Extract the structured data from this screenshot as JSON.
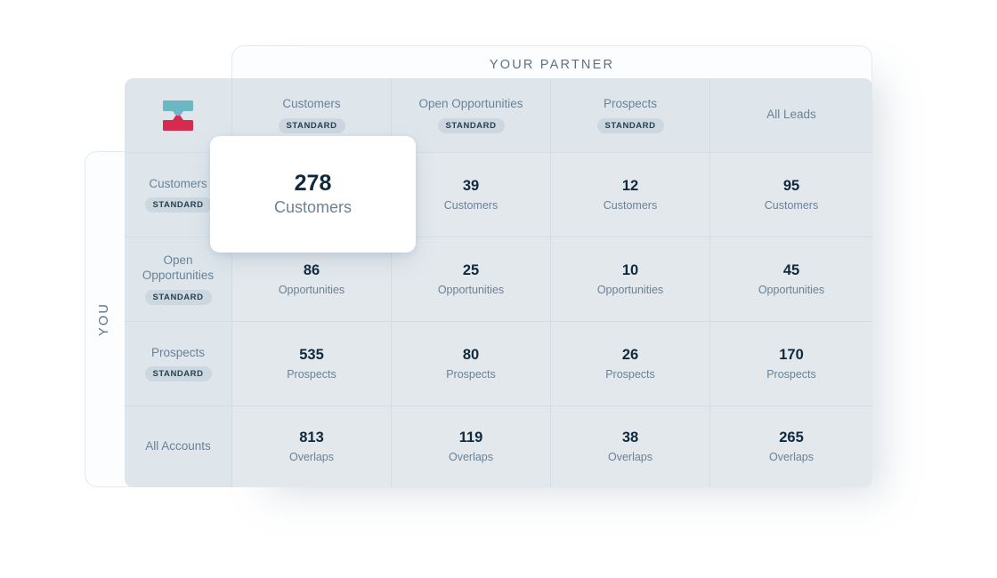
{
  "partner": {
    "title": "YOUR PARTNER"
  },
  "you": {
    "title": "YOU"
  },
  "logo": {
    "name": "crossbeam-logo-icon",
    "top_color": "#6bb8c4",
    "bottom_color": "#d52b4e"
  },
  "badge_label": "STANDARD",
  "columns": [
    {
      "label": "Customers",
      "badge": "STANDARD"
    },
    {
      "label": "Open Opportunities",
      "badge": "STANDARD"
    },
    {
      "label": "Prospects",
      "badge": "STANDARD"
    },
    {
      "label": "All Leads",
      "badge": ""
    }
  ],
  "rows": [
    {
      "label": "Customers",
      "badge": "STANDARD"
    },
    {
      "label": "Open Opportunities",
      "badge": "STANDARD"
    },
    {
      "label": "Prospects",
      "badge": "STANDARD"
    },
    {
      "label": "All Accounts",
      "badge": ""
    }
  ],
  "cells": [
    [
      {
        "value": "278",
        "label": "Customers"
      },
      {
        "value": "39",
        "label": "Customers"
      },
      {
        "value": "12",
        "label": "Customers"
      },
      {
        "value": "95",
        "label": "Customers"
      }
    ],
    [
      {
        "value": "86",
        "label": "Opportunities"
      },
      {
        "value": "25",
        "label": "Opportunities"
      },
      {
        "value": "10",
        "label": "Opportunities"
      },
      {
        "value": "45",
        "label": "Opportunities"
      }
    ],
    [
      {
        "value": "535",
        "label": "Prospects"
      },
      {
        "value": "80",
        "label": "Prospects"
      },
      {
        "value": "26",
        "label": "Prospects"
      },
      {
        "value": "170",
        "label": "Prospects"
      }
    ],
    [
      {
        "value": "813",
        "label": "Overlaps"
      },
      {
        "value": "119",
        "label": "Overlaps"
      },
      {
        "value": "38",
        "label": "Overlaps"
      },
      {
        "value": "265",
        "label": "Overlaps"
      }
    ]
  ],
  "tooltip": {
    "value": "278",
    "label": "Customers"
  },
  "colors": {
    "grid_background": "#e2e8ec",
    "header_background": "#dfe6eb",
    "grid_line": "#d3dde4",
    "card_background": "#fbfdfe",
    "card_border": "#e2eaef",
    "value_text": "#10293c",
    "muted_text": "#6b8296",
    "badge_background": "#ccd7e0"
  },
  "chart_data": {
    "type": "heatmap",
    "title": "Account overlap matrix",
    "xlabel": "YOUR PARTNER",
    "ylabel": "YOU",
    "categories_x": [
      "Customers",
      "Open Opportunities",
      "Prospects",
      "All Leads"
    ],
    "categories_y": [
      "Customers",
      "Open Opportunities",
      "Prospects",
      "All Accounts"
    ],
    "unit_labels_y": [
      "Customers",
      "Opportunities",
      "Prospects",
      "Overlaps"
    ],
    "values": [
      [
        278,
        39,
        12,
        95
      ],
      [
        86,
        25,
        10,
        45
      ],
      [
        535,
        80,
        26,
        170
      ],
      [
        813,
        119,
        38,
        265
      ]
    ],
    "grid": true,
    "legend": "none"
  }
}
